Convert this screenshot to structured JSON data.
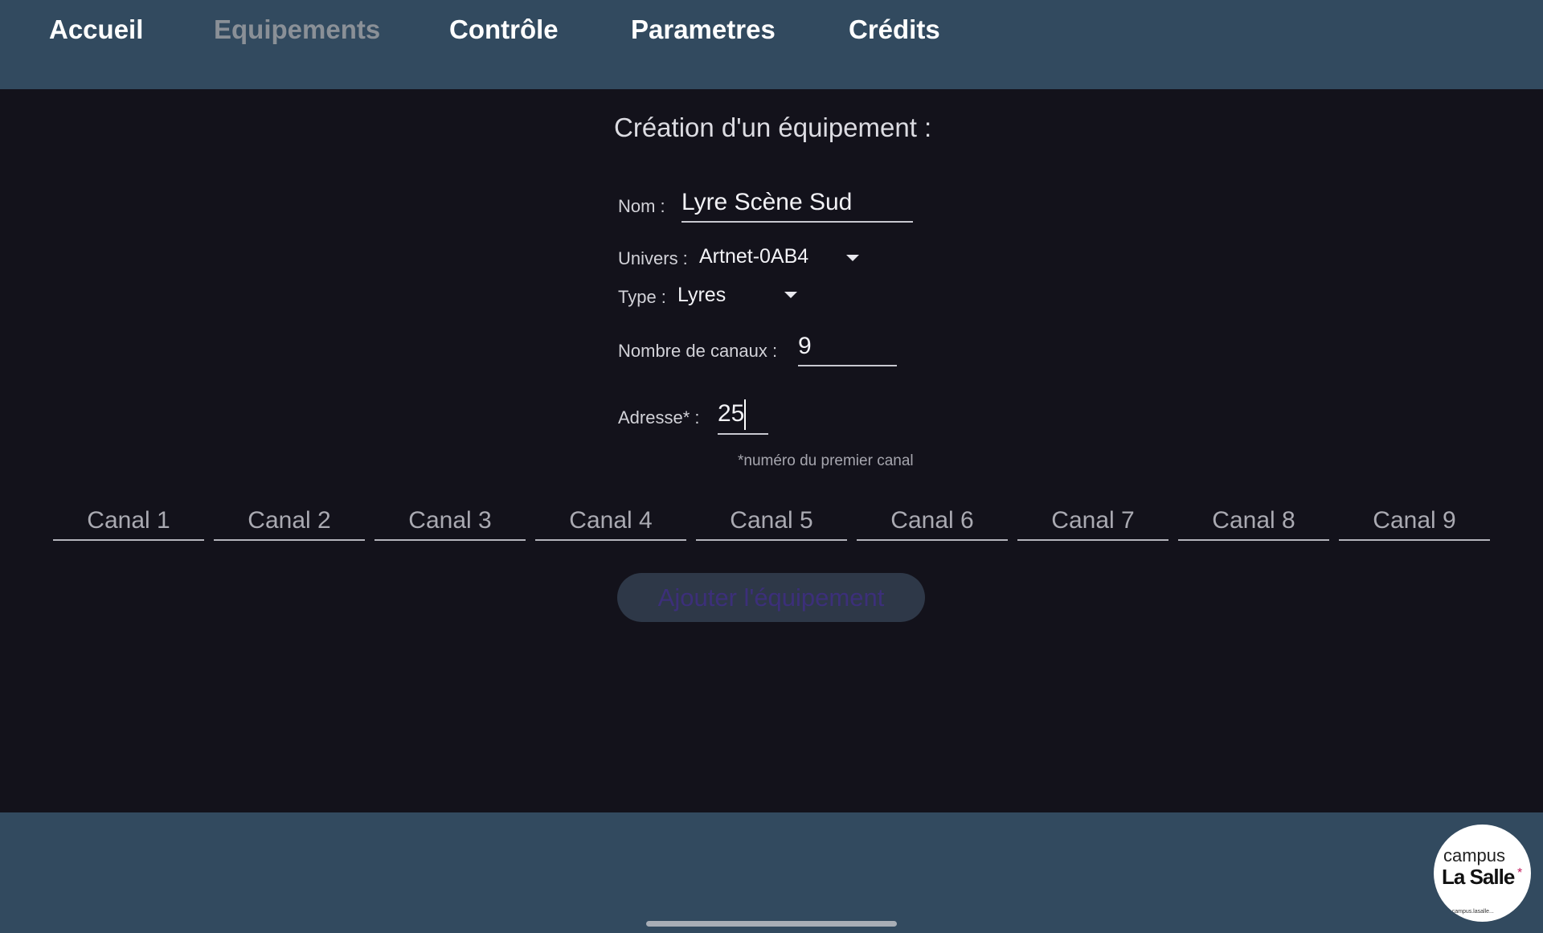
{
  "nav": {
    "items": [
      {
        "label": "Accueil",
        "active": false
      },
      {
        "label": "Equipements",
        "active": true
      },
      {
        "label": "Contrôle",
        "active": false
      },
      {
        "label": "Parametres",
        "active": false
      },
      {
        "label": "Crédits",
        "active": false
      }
    ]
  },
  "form": {
    "title": "Création d'un équipement :",
    "name": {
      "label": "Nom :",
      "value": "Lyre Scène Sud"
    },
    "universe": {
      "label": "Univers :",
      "value": "Artnet-0AB4"
    },
    "type": {
      "label": "Type :",
      "value": "Lyres"
    },
    "channel_count": {
      "label": "Nombre de canaux :",
      "value": "9"
    },
    "address": {
      "label": "Adresse* :",
      "value": "25"
    },
    "address_hint": "*numéro du premier canal",
    "channels": [
      "Canal 1",
      "Canal 2",
      "Canal 3",
      "Canal 4",
      "Canal 5",
      "Canal 6",
      "Canal 7",
      "Canal 8",
      "Canal 9"
    ],
    "submit_label": "Ajouter l'équipement"
  },
  "logo": {
    "line1": "campus",
    "line2": "La Salle",
    "star": "*",
    "url": "www.campus.lasalle..."
  },
  "colors": {
    "bar": "#324a5f",
    "background": "#13121b",
    "nav_active": "#8a9097",
    "button_bg": "#2e3848",
    "button_text": "#3c2f7a"
  }
}
